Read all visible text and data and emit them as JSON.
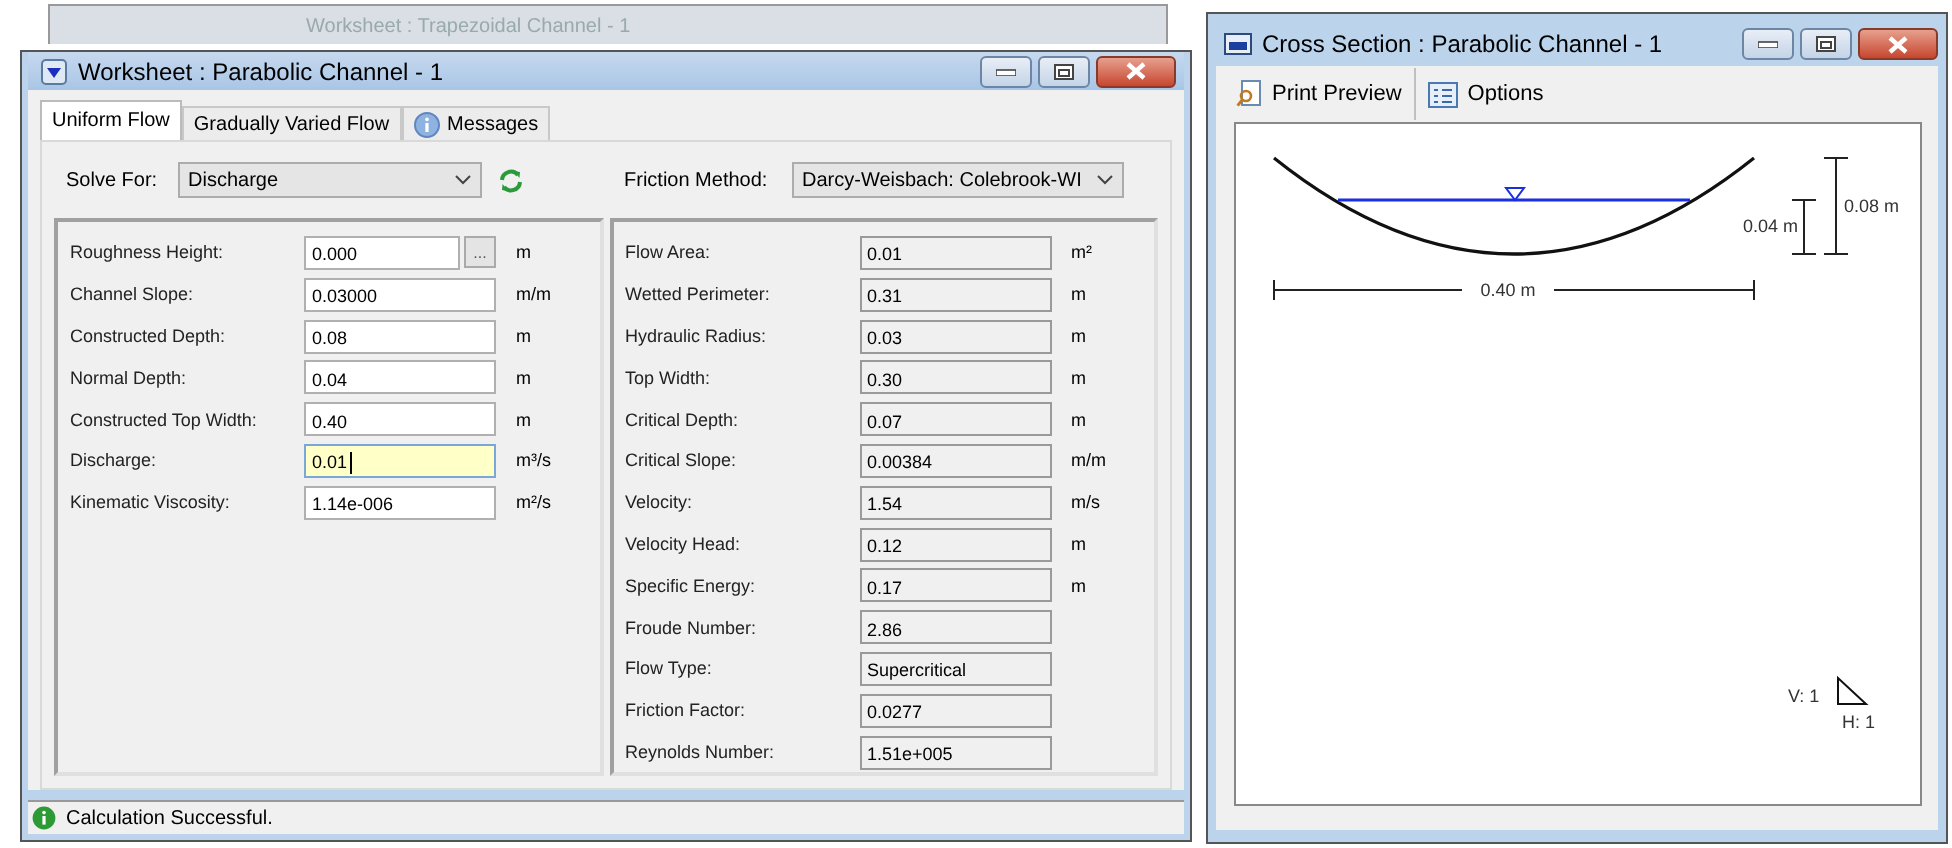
{
  "background_window": {
    "title": "Worksheet : Trapezoidal Channel - 1"
  },
  "worksheet": {
    "title": "Worksheet : Parabolic Channel - 1",
    "tabs": [
      {
        "label": "Uniform Flow",
        "selected": true,
        "kind": "plain"
      },
      {
        "label": "Gradually Varied Flow",
        "selected": false,
        "kind": "plain"
      },
      {
        "label": "Messages",
        "selected": false,
        "kind": "info"
      }
    ],
    "solve_for": {
      "label": "Solve For:",
      "value": "Discharge"
    },
    "friction_method": {
      "label": "Friction Method:",
      "value": "Darcy-Weisbach: Colebrook-WI"
    },
    "inputs": [
      {
        "label": "Roughness Height:",
        "value": "0.000",
        "unit": "m",
        "kind": "browse",
        "browse_label": "...",
        "focused": false
      },
      {
        "label": "Channel Slope:",
        "value": "0.03000",
        "unit": "m/m",
        "kind": "plain",
        "focused": false
      },
      {
        "label": "Constructed Depth:",
        "value": "0.08",
        "unit": "m",
        "kind": "plain",
        "focused": false
      },
      {
        "label": "Normal Depth:",
        "value": "0.04",
        "unit": "m",
        "kind": "plain",
        "focused": false
      },
      {
        "label": "Constructed Top Width:",
        "value": "0.40",
        "unit": "m",
        "kind": "plain",
        "focused": false
      },
      {
        "label": "Discharge:",
        "value": "0.01",
        "unit": "m³/s",
        "kind": "plain",
        "focused": true
      },
      {
        "label": "Kinematic Viscosity:",
        "value": "1.14e-006",
        "unit": "m²/s",
        "kind": "plain",
        "focused": false
      }
    ],
    "results": [
      {
        "label": "Flow Area:",
        "value": "0.01",
        "unit": "m²"
      },
      {
        "label": "Wetted Perimeter:",
        "value": "0.31",
        "unit": "m"
      },
      {
        "label": "Hydraulic Radius:",
        "value": "0.03",
        "unit": "m"
      },
      {
        "label": "Top Width:",
        "value": "0.30",
        "unit": "m"
      },
      {
        "label": "Critical Depth:",
        "value": "0.07",
        "unit": "m"
      },
      {
        "label": "Critical Slope:",
        "value": "0.00384",
        "unit": "m/m"
      },
      {
        "label": "Velocity:",
        "value": "1.54",
        "unit": "m/s"
      },
      {
        "label": "Velocity Head:",
        "value": "0.12",
        "unit": "m"
      },
      {
        "label": "Specific Energy:",
        "value": "0.17",
        "unit": "m"
      },
      {
        "label": "Froude Number:",
        "value": "2.86"
      },
      {
        "label": "Flow Type:",
        "value": "Supercritical"
      },
      {
        "label": "Friction Factor:",
        "value": "0.0277"
      },
      {
        "label": "Reynolds Number:",
        "value": "1.51e+005"
      }
    ],
    "status": "Calculation Successful."
  },
  "cross_section": {
    "title": "Cross Section : Parabolic Channel - 1",
    "toolbar": [
      {
        "label": "Print Preview",
        "kind": "preview"
      },
      {
        "label": "Options",
        "kind": "options"
      }
    ],
    "labels": {
      "top_width": "0.40 m",
      "total_depth": "0.08 m",
      "normal_depth": "0.04 m",
      "v_scale": "V: 1",
      "h_scale": "H: 1"
    }
  }
}
